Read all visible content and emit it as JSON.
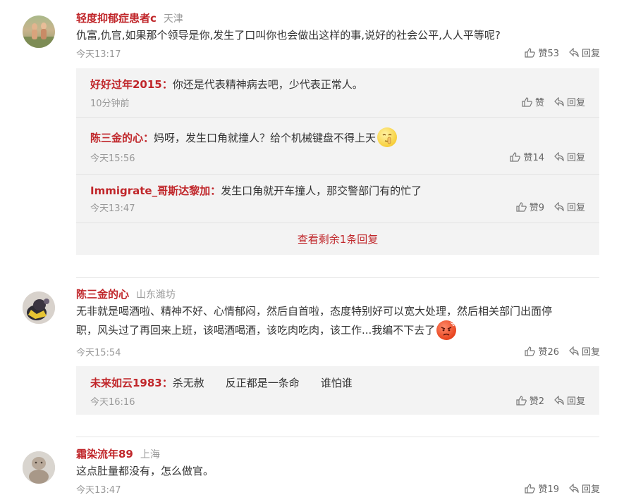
{
  "comments": [
    {
      "user": "轻度抑郁症患者c",
      "location": "天津",
      "text": "仇富,仇官,如果那个领导是你,发生了口叫你也会做出这样的事,说好的社会公平,人人平等呢?",
      "time": "今天13:17",
      "like_label": "赞53",
      "reply_label": "回复",
      "replies": [
        {
          "user": "好好过年2015：",
          "text": "你还是代表精神病去吧，少代表正常人。",
          "time": "10分钟前",
          "like_label": "赞",
          "reply_label": "回复"
        },
        {
          "user": "陈三金的心：",
          "text": "妈呀，发生口角就撞人？给个机械键盘不得上天",
          "time": "今天15:56",
          "like_label": "赞14",
          "reply_label": "回复",
          "emoji": "shush-emoji"
        },
        {
          "user": "Immigrate_哥斯达黎加：",
          "text": "发生口角就开车撞人，那交警部门有的忙了",
          "time": "今天13:47",
          "like_label": "赞9",
          "reply_label": "回复"
        }
      ],
      "more_replies": "查看剩余1条回复"
    },
    {
      "user": "陈三金的心",
      "location": "山东潍坊",
      "text_line1": "无非就是喝酒啦、精神不好、心情郁闷，然后自首啦，态度特别好可以宽大处理，然后相关部门出面停",
      "text_line2": "职，风头过了再回来上班，该喝酒喝酒，该吃肉吃肉，该工作...我编不下去了",
      "time": "今天15:54",
      "like_label": "赞26",
      "reply_label": "回复",
      "emoji": "angry-emoji",
      "replies": [
        {
          "user": "未来如云1983：",
          "text": "杀无赦　　反正都是一条命　　谁怕谁",
          "time": "今天16:16",
          "like_label": "赞2",
          "reply_label": "回复"
        }
      ]
    },
    {
      "user": "霜染流年89",
      "location": "上海",
      "text": "这点肚量都没有，怎么做官。",
      "time": "今天13:47",
      "like_label": "赞19",
      "reply_label": "回复"
    }
  ],
  "colors": {
    "username": "#c0262a",
    "reply_bg": "#f3f3f3",
    "muted": "#999999"
  },
  "icons": {
    "like": "thumb-up-icon",
    "reply": "reply-arrow-icon"
  }
}
